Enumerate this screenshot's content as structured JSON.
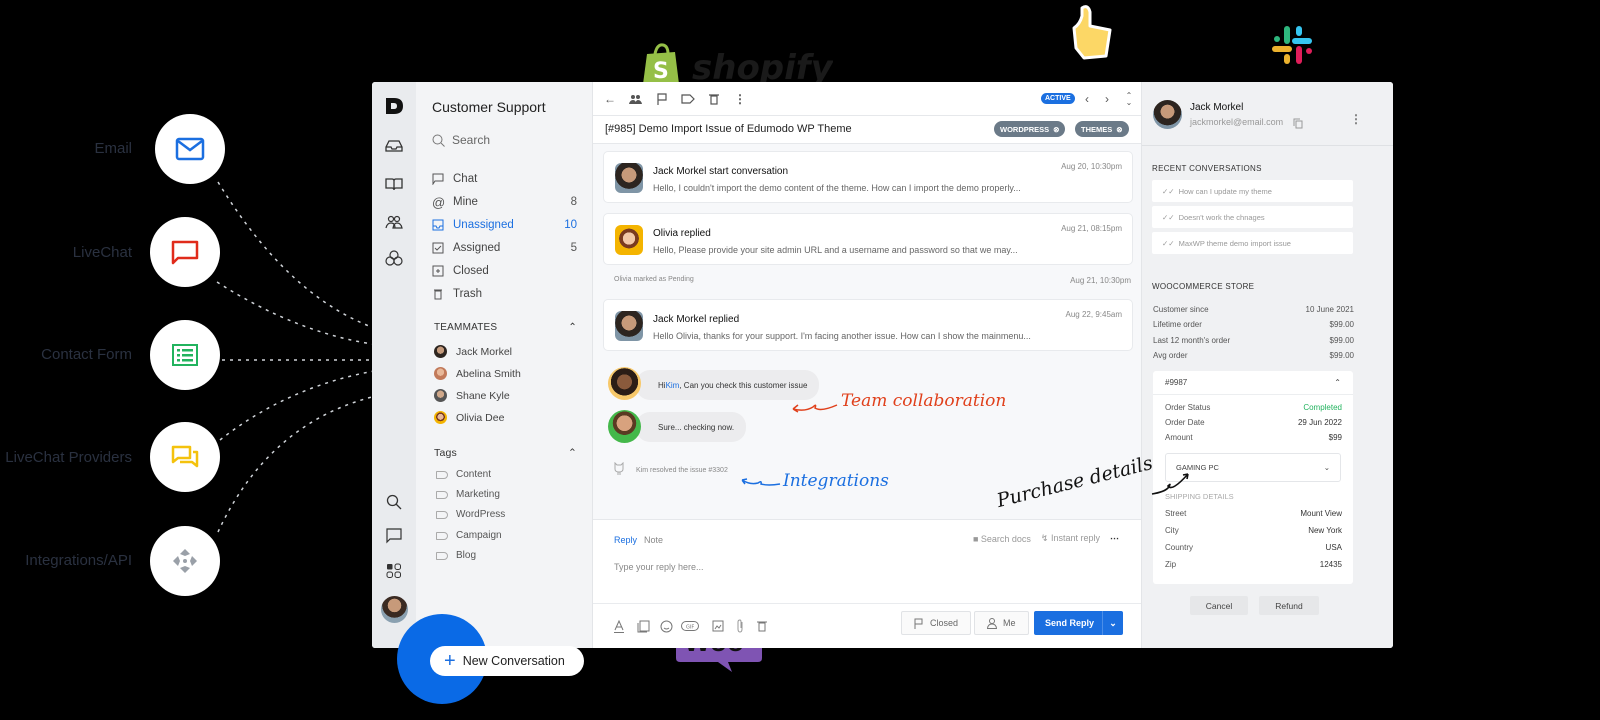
{
  "channels": [
    {
      "label": "Email",
      "icon": "email-icon",
      "color": "#1b6fe0"
    },
    {
      "label": "LiveChat",
      "icon": "chat-bubble-icon",
      "color": "#e02b1b"
    },
    {
      "label": "Contact Form",
      "icon": "form-list-icon",
      "color": "#22b35e"
    },
    {
      "label": "LiveChat Providers",
      "icon": "chat-bubbles-icon",
      "color": "#f4c20d"
    },
    {
      "label": "Integrations/API",
      "icon": "integrations-icon",
      "color": "#9aa0a8"
    }
  ],
  "logos": {
    "shopify": "shopify",
    "woo": "Woo"
  },
  "nav": {
    "title": "Customer Support",
    "search_placeholder": "Search",
    "items": [
      {
        "label": "Chat",
        "count": "",
        "icon": "chat-icon"
      },
      {
        "label": "Mine",
        "count": "8",
        "icon": "at-icon"
      },
      {
        "label": "Unassigned",
        "count": "10",
        "icon": "inbox-icon",
        "active": true
      },
      {
        "label": "Assigned",
        "count": "5",
        "icon": "checkbox-icon"
      },
      {
        "label": "Closed",
        "count": "",
        "icon": "archive-icon"
      },
      {
        "label": "Trash",
        "count": "",
        "icon": "trash-icon"
      }
    ],
    "teammates_title": "TEAMMATES",
    "teammates": [
      "Jack Morkel",
      "Abelina Smith",
      "Shane Kyle",
      "Olivia Dee"
    ],
    "tags_title": "Tags",
    "tags": [
      "Content",
      "Marketing",
      "WordPress",
      "Campaign",
      "Blog"
    ]
  },
  "conversation": {
    "status": "ACTIVE",
    "subject": "[#985] Demo Import Issue of Edumodo WP Theme",
    "chips": [
      "WORDPRESS",
      "THEMES"
    ],
    "messages": [
      {
        "name": "Jack Morkel start conversation",
        "text": "Hello, I couldn't import the demo content of the theme. How can I import the demo properly...",
        "time": "Aug 20, 10:30pm"
      },
      {
        "name": "Olivia replied",
        "text": "Hello, Please provide your site admin URL and a username and password so that we may...",
        "time": "Aug 21, 08:15pm"
      },
      {
        "name": "Jack Morkel replied",
        "text": "Hello Olivia, thanks for your support. I'm facing another issue. How can I show the mainmenu...",
        "time": "Aug 22, 9:45am"
      }
    ],
    "system_event": {
      "text": "Olivia marked as Pending",
      "time": "Aug 21, 10:30pm"
    },
    "internal_notes": [
      {
        "prefix": "Hi ",
        "mention": "Kim",
        "suffix": ", Can you check this customer issue"
      },
      {
        "prefix": "Sure... checking now.",
        "mention": "",
        "suffix": ""
      }
    ],
    "integration_event": "Kim resolved the issue #3302",
    "annotations": {
      "team": "Team collaboration",
      "integrations": "Integrations",
      "purchase": "Purchase details"
    }
  },
  "reply": {
    "tab_reply": "Reply",
    "tab_note": "Note",
    "placeholder": "Type your reply here...",
    "search_docs": "Search docs",
    "instant_reply": "Instant reply",
    "status_button": "Closed",
    "assignee_button": "Me",
    "send_button": "Send Reply"
  },
  "customer": {
    "name": "Jack Morkel",
    "email": "jackmorkel@email.com",
    "recent_title": "RECENT CONVERSATIONS",
    "recent": [
      "How can I update my theme",
      "Doesn't work the chnages",
      "MaxWP theme demo import issue"
    ],
    "store_title": "WOOCOMMERCE STORE",
    "store": [
      {
        "k": "Customer since",
        "v": "10 June 2021"
      },
      {
        "k": "Lifetime order",
        "v": "$99.00"
      },
      {
        "k": "Last 12 month's order",
        "v": "$99.00"
      },
      {
        "k": "Avg order",
        "v": "$99.00"
      }
    ],
    "order": {
      "id": "#9987",
      "rows": [
        {
          "k": "Order Status",
          "v": "Completed"
        },
        {
          "k": "Order Date",
          "v": "29 Jun 2022"
        },
        {
          "k": "Amount",
          "v": "$99"
        }
      ],
      "product": "GAMING PC",
      "shipping_title": "SHIPPING DETAILS",
      "shipping": [
        {
          "k": "Street",
          "v": "Mount View"
        },
        {
          "k": "City",
          "v": "New York"
        },
        {
          "k": "Country",
          "v": "USA"
        },
        {
          "k": "Zip",
          "v": "12435"
        }
      ]
    },
    "cancel": "Cancel",
    "refund": "Refund"
  },
  "fab": {
    "label": "New Conversation"
  },
  "colors": {
    "accent": "#1b6fe0",
    "completed": "#22b35e",
    "team_annot": "#e0401b",
    "integ_annot": "#1b6fe0"
  }
}
